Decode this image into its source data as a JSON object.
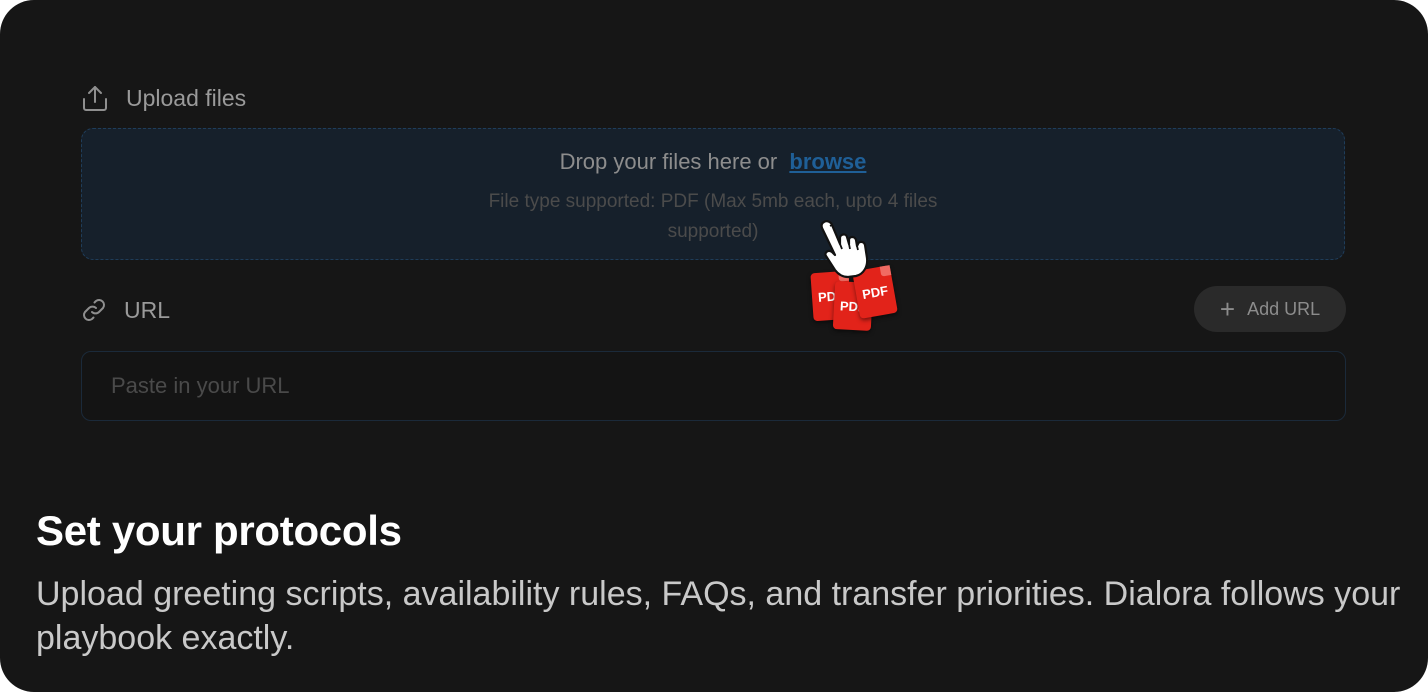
{
  "upload": {
    "header_label": "Upload files",
    "icon": "upload-icon",
    "drop_text": "Drop your files here or",
    "browse_label": "browse",
    "supported_text": "File type supported: PDF (Max 5mb each, upto 4 files supported)"
  },
  "url": {
    "header_label": "URL",
    "icon": "link-icon",
    "add_button_label": "Add URL",
    "input_placeholder": "Paste in your URL"
  },
  "decoration": {
    "pdf_labels": [
      "PDF",
      "PDF",
      "PDF"
    ],
    "pdf_color": "#e2231a"
  },
  "feature": {
    "title": "Set your protocols",
    "description": "Upload greeting scripts, availability rules, FAQs, and transfer priorities. Dialora follows your playbook exactly."
  },
  "colors": {
    "background": "#161616",
    "link": "#1f5f97",
    "dropzone_border": "#1f3d5a"
  }
}
